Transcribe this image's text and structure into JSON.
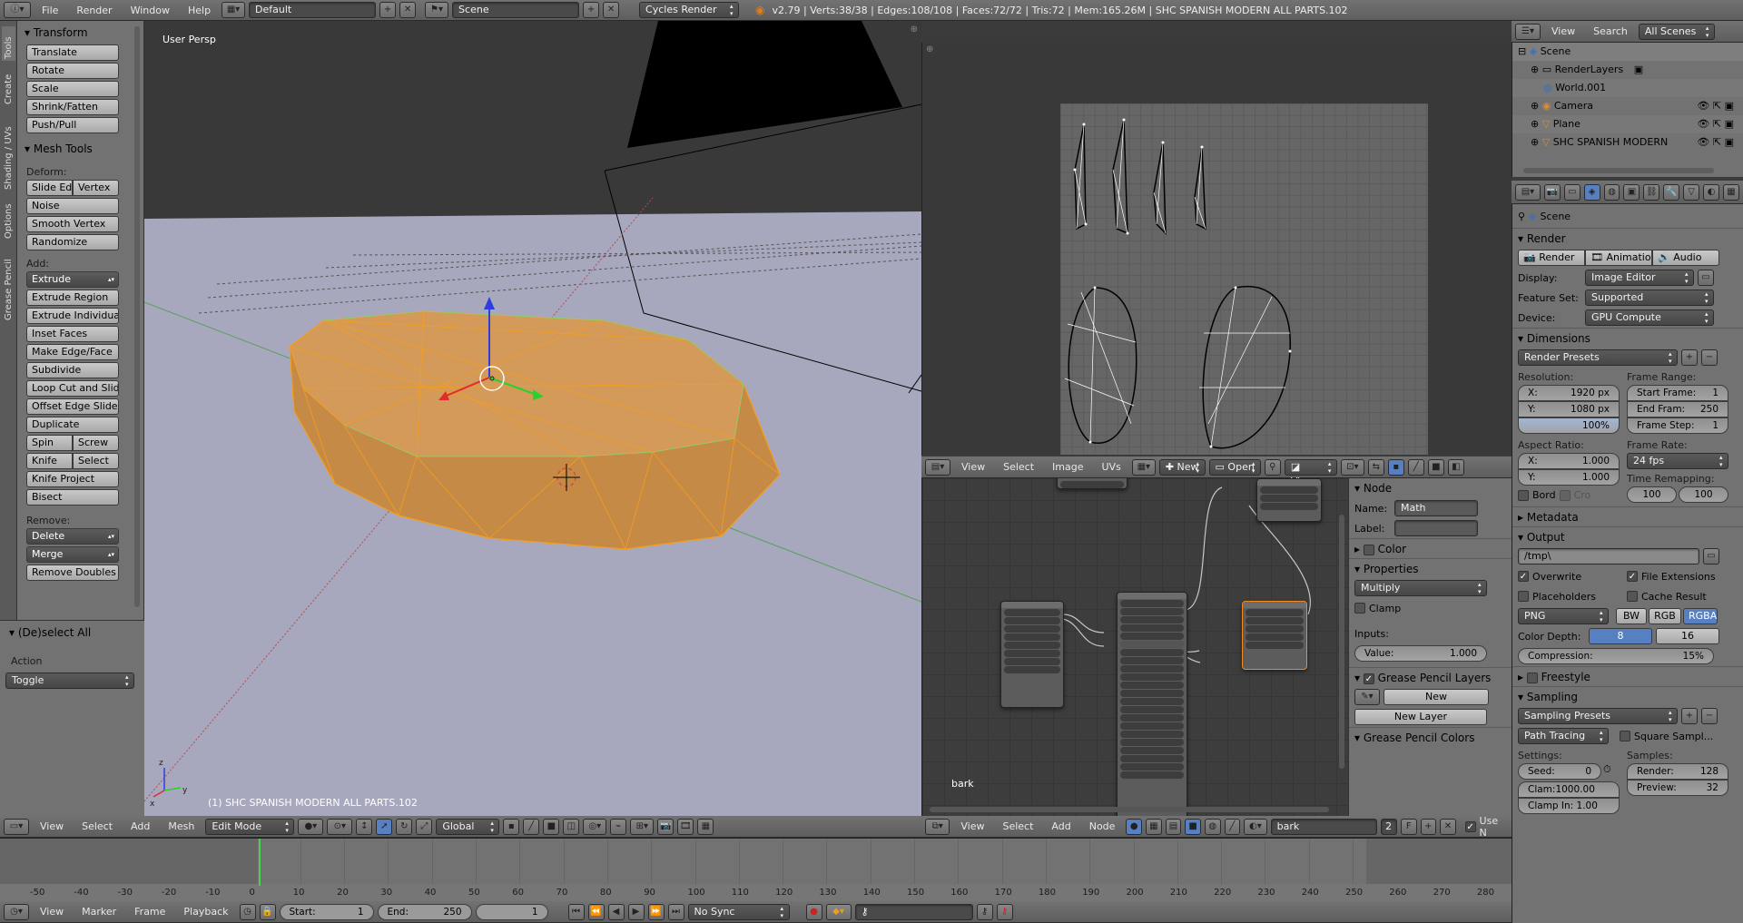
{
  "topbar": {
    "menus": [
      "File",
      "Render",
      "Window",
      "Help"
    ],
    "layout": "Default",
    "scene": "Scene",
    "engine": "Cycles Render",
    "stats": "v2.79 | Verts:38/38 | Edges:108/108 | Faces:72/72 | Tris:72 | Mem:165.26M | SHC SPANISH MODERN ALL PARTS.102"
  },
  "vtabs": [
    "Tools",
    "Create",
    "Shading / UVs",
    "Options",
    "Grease Pencil"
  ],
  "tools": {
    "transform_title": "Transform",
    "transform": [
      "Translate",
      "Rotate",
      "Scale",
      "Shrink/Fatten",
      "Push/Pull"
    ],
    "mesh_title": "Mesh Tools",
    "deform_label": "Deform:",
    "slide_edge": "Slide Ed",
    "vertex": "Vertex",
    "noise": "Noise",
    "smooth_vertex": "Smooth Vertex",
    "randomize": "Randomize",
    "add_label": "Add:",
    "extrude": "Extrude",
    "add": [
      "Extrude Region",
      "Extrude Individual",
      "Inset Faces",
      "Make Edge/Face",
      "Subdivide",
      "Loop Cut and Slide",
      "Offset Edge Slide",
      "Duplicate"
    ],
    "spin": "Spin",
    "screw": "Screw",
    "knife": "Knife",
    "select": "Select",
    "knife_project": "Knife Project",
    "bisect": "Bisect",
    "remove_label": "Remove:",
    "delete": "Delete",
    "merge": "Merge",
    "remove_doubles": "Remove Doubles"
  },
  "operator": {
    "title": "(De)select All",
    "action_label": "Action",
    "action_value": "Toggle"
  },
  "viewport": {
    "label": "User Persp",
    "object": "(1) SHC SPANISH MODERN ALL PARTS.102",
    "menus": [
      "View",
      "Select",
      "Add",
      "Mesh"
    ],
    "mode": "Edit Mode",
    "orientation": "Global"
  },
  "image_editor": {
    "menus": [
      "View",
      "Select",
      "Image",
      "UVs"
    ],
    "new": "New",
    "open": "Open",
    "view": "View"
  },
  "node_editor": {
    "material_label": "bark",
    "menus": [
      "View",
      "Select",
      "Add",
      "Node"
    ],
    "material": "bark",
    "users": "2",
    "use_nodes": "Use N"
  },
  "node_panel": {
    "node_title": "Node",
    "name_label": "Name:",
    "name_value": "Math",
    "label_label": "Label:",
    "color": "Color",
    "properties": "Properties",
    "operation": "Multiply",
    "clamp": "Clamp",
    "inputs": "Inputs:",
    "value_label": "Value:",
    "value": "1.000",
    "gp_layers": "Grease Pencil Layers",
    "new": "New",
    "new_layer": "New Layer",
    "gp_colors": "Grease Pencil Colors"
  },
  "outliner": {
    "menus": [
      "View",
      "Search"
    ],
    "filter": "All Scenes",
    "items": [
      "Scene",
      "RenderLayers",
      "World.001",
      "Camera",
      "Plane",
      "SHC SPANISH MODERN"
    ]
  },
  "properties": {
    "context": "Scene",
    "render_title": "Render",
    "render_tabs": [
      "Render",
      "Animation",
      "Audio"
    ],
    "display_label": "Display:",
    "display": "Image Editor",
    "feature_label": "Feature Set:",
    "feature": "Supported",
    "device_label": "Device:",
    "device": "GPU Compute",
    "dimensions": "Dimensions",
    "render_presets": "Render Presets",
    "resolution": "Resolution:",
    "res_x": "1920 px",
    "res_y": "1080 px",
    "res_pct": "100%",
    "frame_range": "Frame Range:",
    "start_frame": "Start Frame:",
    "start_val": "1",
    "end_frame": "End Fram:",
    "end_val": "250",
    "frame_step": "Frame Step:",
    "step_val": "1",
    "aspect": "Aspect Ratio:",
    "asp_x": "1.000",
    "asp_y": "1.000",
    "frame_rate": "Frame Rate:",
    "fps": "24 fps",
    "time_remap": "Time Remapping:",
    "remap_a": "100",
    "remap_b": "100",
    "bord": "Bord",
    "cro": "Cro",
    "metadata": "Metadata",
    "output": "Output",
    "path": "/tmp\\",
    "overwrite": "Overwrite",
    "file_ext": "File Extensions",
    "placeholders": "Placeholders",
    "cache_result": "Cache Result",
    "format": "PNG",
    "bw": "BW",
    "rgb": "RGB",
    "rgba": "RGBA",
    "color_depth": "Color Depth:",
    "d8": "8",
    "d16": "16",
    "compression": "Compression:",
    "comp_val": "15%",
    "freestyle": "Freestyle",
    "sampling": "Sampling",
    "sampling_presets": "Sampling Presets",
    "path_tracing": "Path Tracing",
    "square_samples": "Square Sampl...",
    "settings": "Settings:",
    "samples": "Samples:",
    "seed": "Seed:",
    "seed_val": "0",
    "render_s": "Render:",
    "render_val": "128",
    "clamp_d": "Clam:1000.00",
    "preview": "Preview:",
    "preview_val": "32",
    "clamp_i": "Clamp In: 1.00"
  },
  "timeline": {
    "ticks": [
      "-50",
      "-40",
      "-30",
      "-20",
      "-10",
      "0",
      "10",
      "20",
      "30",
      "40",
      "50",
      "60",
      "70",
      "80",
      "90",
      "100",
      "110",
      "120",
      "130",
      "140",
      "150",
      "160",
      "170",
      "180",
      "190",
      "200",
      "210",
      "220",
      "230",
      "240",
      "250",
      "260",
      "270",
      "280"
    ],
    "menus": [
      "View",
      "Marker",
      "Frame",
      "Playback"
    ],
    "start_label": "Start:",
    "start": "1",
    "end_label": "End:",
    "end": "250",
    "current": "1",
    "sync": "No Sync"
  }
}
